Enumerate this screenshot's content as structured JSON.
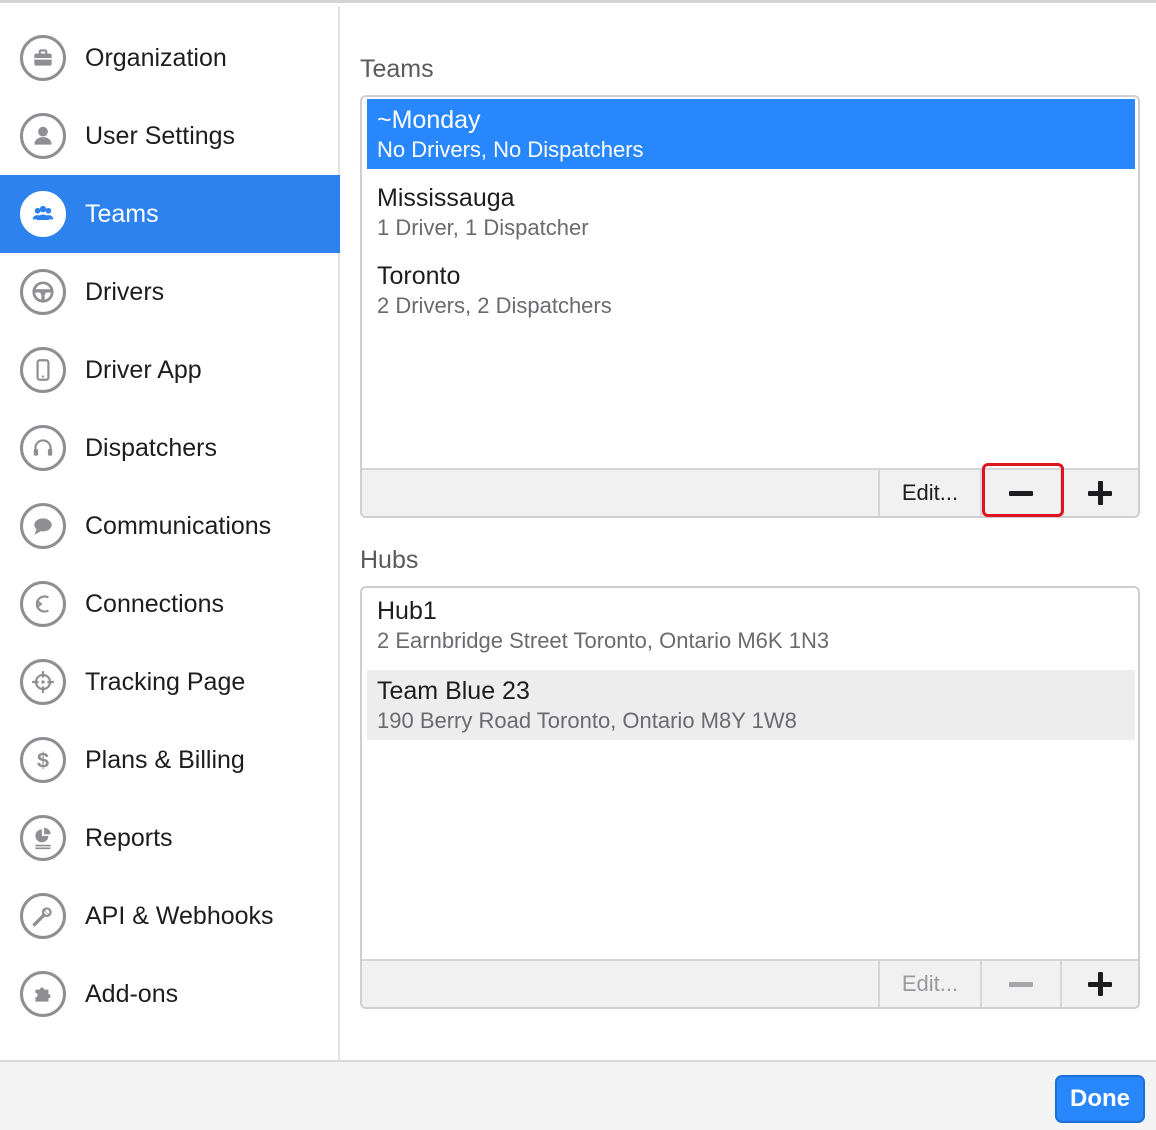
{
  "sidebar": {
    "items": [
      {
        "label": "Organization",
        "icon": "briefcase-icon"
      },
      {
        "label": "User Settings",
        "icon": "user-icon"
      },
      {
        "label": "Teams",
        "icon": "team-icon",
        "active": true
      },
      {
        "label": "Drivers",
        "icon": "steering-wheel-icon"
      },
      {
        "label": "Driver App",
        "icon": "phone-icon"
      },
      {
        "label": "Dispatchers",
        "icon": "headset-icon"
      },
      {
        "label": "Communications",
        "icon": "chat-bubble-icon"
      },
      {
        "label": "Connections",
        "icon": "connections-icon"
      },
      {
        "label": "Tracking Page",
        "icon": "crosshair-icon"
      },
      {
        "label": "Plans & Billing",
        "icon": "dollar-icon"
      },
      {
        "label": "Reports",
        "icon": "report-icon"
      },
      {
        "label": "API & Webhooks",
        "icon": "wrench-icon"
      },
      {
        "label": "Add-ons",
        "icon": "puzzle-icon"
      }
    ]
  },
  "teams": {
    "title": "Teams",
    "rows": [
      {
        "name": "~Monday",
        "sub": "No Drivers, No Dispatchers"
      },
      {
        "name": "Mississauga",
        "sub": "1 Driver, 1 Dispatcher"
      },
      {
        "name": "Toronto",
        "sub": "2 Drivers, 2 Dispatchers"
      }
    ],
    "edit_label": "Edit..."
  },
  "hubs": {
    "title": "Hubs",
    "rows": [
      {
        "name": "Hub1",
        "sub": "2 Earnbridge Street Toronto, Ontario M6K 1N3"
      },
      {
        "name": "Team Blue 23",
        "sub": "190 Berry Road Toronto, Ontario M8Y 1W8"
      }
    ],
    "edit_label": "Edit..."
  },
  "footer": {
    "done_label": "Done"
  },
  "colors": {
    "accent": "#2887fc",
    "highlight_outline": "#e0141e"
  }
}
